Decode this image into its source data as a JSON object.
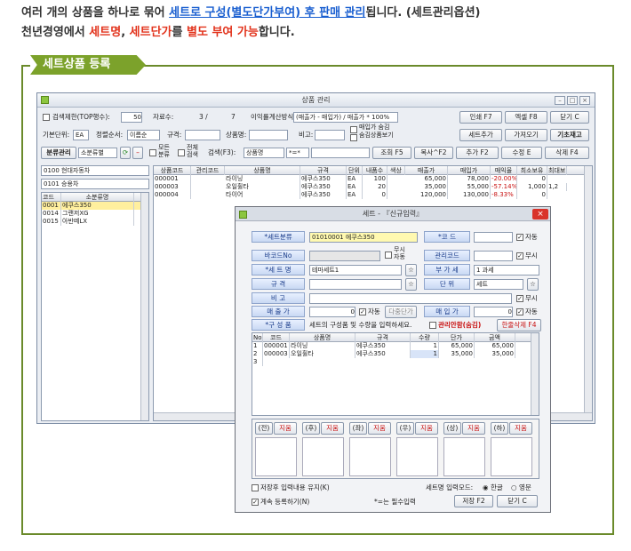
{
  "intro": {
    "line1_a": "여러 개의 상품을 하나로 묶어 ",
    "line1_b": "세트로 구성(별도단가부여) 후 판매 관리",
    "line1_c": "됩니다. (세트관리옵션)",
    "line2_a": "천년경영에서 ",
    "line2_b": "세트명",
    "line2_c": ", ",
    "line2_d": "세트단가",
    "line2_e": "를 ",
    "line2_f": "별도 부여 가능",
    "line2_g": "합니다."
  },
  "section": {
    "title": "세트상품 등록"
  },
  "main_window": {
    "title": "상품 관리",
    "toolbar1": {
      "search_limit_label": "검색제한(TOP행수):",
      "search_limit_value": "50",
      "record_label": "자료수:",
      "record_value": "3 /",
      "record_total": "7",
      "margin_label": "이익률계산방식:",
      "margin_value": "(매출가 - 매입가) / 매출가 * 100%",
      "print_btn": "인쇄 F7",
      "excel_btn": "엑셀 F8",
      "close_btn": "닫기 C"
    },
    "toolbar2": {
      "unit_label": "기본단위:",
      "unit_value": "EA",
      "sort_label": "정렬순서:",
      "sort_value": "이름순",
      "spec_label": "규격:",
      "name_label": "상품명:",
      "note_label": "비고:",
      "buy_label1": "매입가 숨김",
      "buy_label2": "숨김상품보기",
      "set_add_btn": "세트추가",
      "import_btn": "가져오기",
      "basic_btn": "기초재고"
    },
    "toolbar3": {
      "cat_btn": "분류관리",
      "cat_sel": "소분류별",
      "all_cat_1": "모든",
      "all_cat_2": "분류",
      "all_grid_1": "전체",
      "all_grid_2": "검색",
      "search_label": "검색(F3):",
      "search_field": "상품명",
      "search_op": "*=*",
      "query_btn": "조회 F5",
      "copy_btn": "복사^F2",
      "add_btn": "추가 F2",
      "edit_btn": "수정 E",
      "delete_btn": "삭제 F4"
    },
    "left_panel": {
      "cat1": "0100 현대자동차",
      "cat2": "0101 승용차",
      "cols": [
        "코드",
        "소분류명"
      ],
      "rows": [
        {
          "code": "0001",
          "name": "에쿠스350"
        },
        {
          "code": "0014",
          "name": "그랜저XG"
        },
        {
          "code": "0015",
          "name": "아반떼LX"
        }
      ]
    },
    "product_grid": {
      "cols": [
        "상품코드",
        "관리코드",
        "상품명",
        "규격",
        "단위",
        "내품수",
        "색상",
        "매출가",
        "매입가",
        "매익율",
        "최소보유",
        "최대보"
      ],
      "rows": [
        {
          "code": "000001",
          "mgmt": "",
          "name": "라이닝",
          "spec": "에쿠스350",
          "unit": "EA",
          "qty": "100",
          "color": "#00d400",
          "sale": "65,000",
          "buy": "78,000",
          "rate": "-20.00%",
          "min": "0",
          "max": ""
        },
        {
          "code": "000003",
          "mgmt": "",
          "name": "오일휠타",
          "spec": "에쿠스350",
          "unit": "EA",
          "qty": "20",
          "color": "#ffef00",
          "sale": "35,000",
          "buy": "55,000",
          "rate": "-57.14%",
          "min": "1,000",
          "max": "1,2"
        },
        {
          "code": "000004",
          "mgmt": "",
          "name": "타이어",
          "spec": "에쿠스350",
          "unit": "EA",
          "qty": "0",
          "color": "#ff2020",
          "sale": "120,000",
          "buy": "130,000",
          "rate": "-8.33%",
          "min": "0",
          "max": ""
        }
      ]
    }
  },
  "dialog": {
    "title": "세트 - 『신규입력』",
    "set_cat_label": "*세트분류",
    "set_cat_value": "01010001 에쿠스350",
    "code_label": "*코  드",
    "auto_label": "자동",
    "barcode_label": "바코드No",
    "free_label": "무시",
    "mgmt_label": "관리코드",
    "setname_label": "*세 트 명",
    "setname_value": "테마세트1",
    "vat_label": "부 가 세",
    "vat_value": "1 과세",
    "spec_label": "규   격",
    "unit_label": "단   위",
    "unit_value": "세트",
    "note_label": "비   고",
    "sale_label": "매 출 가",
    "sale_value": "0",
    "multi_btn": "다중단가",
    "buy_label": "매 입 가",
    "buy_value": "0",
    "comp_label": "*구 성 품",
    "comp_hint": "세트의 구성품 및 수량을 입력하세요.",
    "mgmt_hide": "관리안함(숨김)",
    "comp_delete_btn": "한줄삭제 F4",
    "comp_cols": [
      "No",
      "코드",
      "상품명",
      "규격",
      "수량",
      "단가",
      "금액"
    ],
    "comp_rows": [
      {
        "no": "1",
        "code": "000001",
        "name": "라이닝",
        "spec": "에쿠스350",
        "qty": "1",
        "price": "65,000",
        "amount": "65,000"
      },
      {
        "no": "2",
        "code": "000003",
        "name": "오일휠타",
        "spec": "에쿠스350",
        "qty": "1",
        "price": "35,000",
        "amount": "35,000"
      },
      {
        "no": "3",
        "code": "",
        "name": "",
        "spec": "",
        "qty": "",
        "price": "",
        "amount": ""
      }
    ],
    "image_tabs": [
      {
        "label": "(전)",
        "del": "지움"
      },
      {
        "label": "(후)",
        "del": "지움"
      },
      {
        "label": "(좌)",
        "del": "지움"
      },
      {
        "label": "(우)",
        "del": "지움"
      },
      {
        "label": "(상)",
        "del": "지움"
      },
      {
        "label": "(하)",
        "del": "지움"
      }
    ],
    "keep_label": "저장후 입력내용 유지(K)",
    "mode_label": "세트명 입력모드:",
    "mode_ko": "한글",
    "mode_en": "영문",
    "cont_label": "계속 등록하기(N)",
    "required_label": "*=는 필수입력",
    "save_btn": "저장 F2",
    "close_btn": "닫기 C"
  }
}
